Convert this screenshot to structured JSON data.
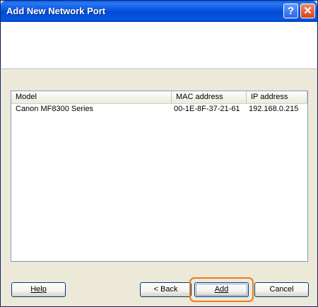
{
  "window": {
    "title": "Add New Network Port",
    "help_glyph": "?",
    "close_glyph": "✕"
  },
  "list": {
    "columns": [
      "Model",
      "MAC address",
      "IP address"
    ],
    "rows": [
      {
        "model": "Canon MF8300 Series",
        "mac": "00-1E-8F-37-21-61",
        "ip": "192.168.0.215"
      }
    ]
  },
  "buttons": {
    "help": "Help",
    "back": "< Back",
    "add": "Add",
    "cancel": "Cancel"
  },
  "colors": {
    "titlebar": "#0558e2",
    "highlight_ring": "#f07a1a"
  }
}
